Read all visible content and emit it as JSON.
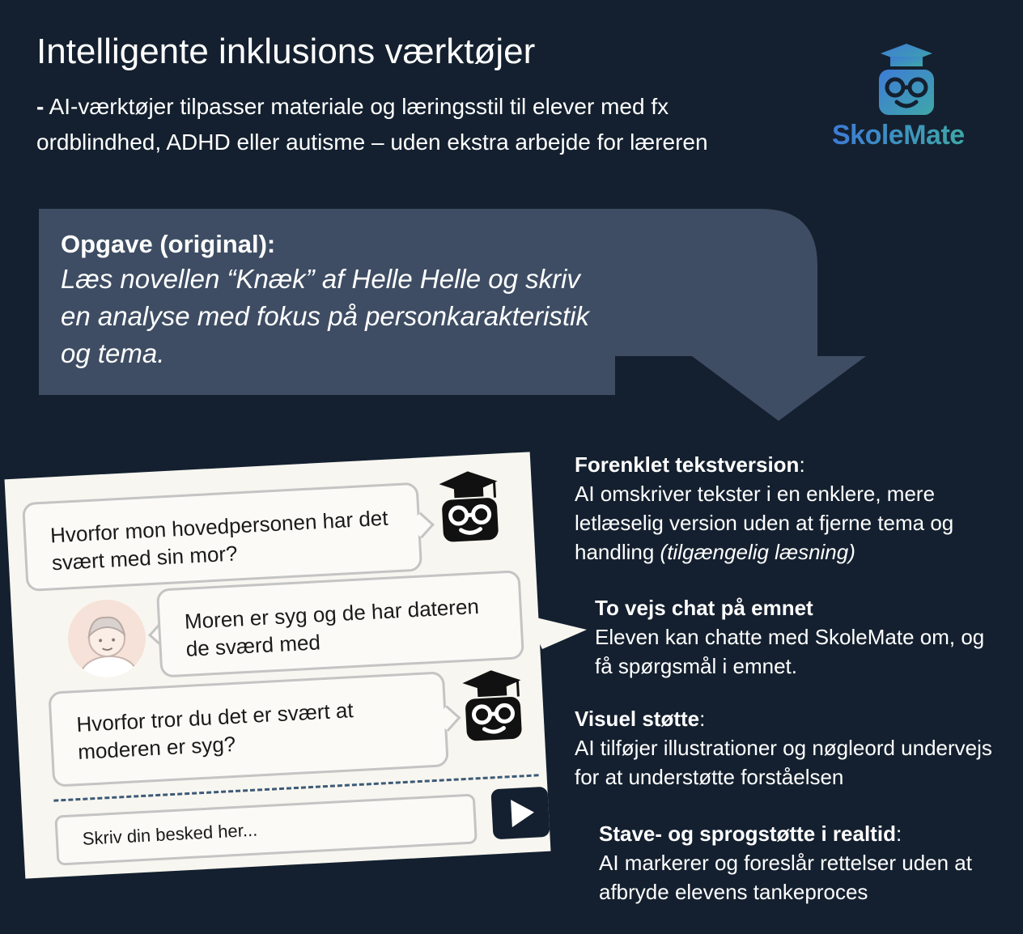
{
  "header": {
    "title": "Intelligente inklusions værktøjer",
    "subtitle_dash": "-",
    "subtitle": "AI-værktøjer tilpasser materiale og læringsstil til elever med fx ordblindhed, ADHD eller autisme – uden ekstra arbejde for læreren"
  },
  "logo": {
    "name": "SkoleMate"
  },
  "task": {
    "label": "Opgave (original):",
    "text": "Læs novellen “Knæk” af Helle Helle og skriv en analyse med fokus på personkarakteristik og tema."
  },
  "chat": {
    "messages": [
      {
        "sender": "bot",
        "text": "Hvorfor mon hovedpersonen har det svært med sin mor?"
      },
      {
        "sender": "student",
        "text": "Moren er syg og de har dateren de sværd med"
      },
      {
        "sender": "bot",
        "text": "Hvorfor tror du det er svært at moderen er syg?"
      }
    ],
    "input_placeholder": "Skriv din besked her...",
    "send_icon": "play-icon"
  },
  "features": [
    {
      "heading": "Forenklet tekstversion",
      "heading_suffix": ":",
      "text": "AI omskriver tekster i en enklere, mere letlæselig version uden at fjerne tema og handling",
      "italic": "(tilgængelig læsning)"
    },
    {
      "heading": "To vejs chat på emnet",
      "heading_suffix": "",
      "text": "Eleven kan chatte med SkoleMate om, og få spørgsmål i emnet.",
      "italic": ""
    },
    {
      "heading": "Visuel støtte",
      "heading_suffix": ":",
      "text": "AI tilføjer illustrationer og nøgleord undervejs for at understøtte forståelsen",
      "italic": ""
    },
    {
      "heading": "Stave- og sprogstøtte i realtid",
      "heading_suffix": ":",
      "text": "AI markerer og foreslår rettelser uden at afbryde elevens tankeproces",
      "italic": ""
    }
  ],
  "colors": {
    "background": "#14202f",
    "arrow": "#3e4d63",
    "chat_panel": "#f8f6f0",
    "logo_gradient_start": "#3d7bd6",
    "logo_gradient_end": "#3fa7a8"
  }
}
